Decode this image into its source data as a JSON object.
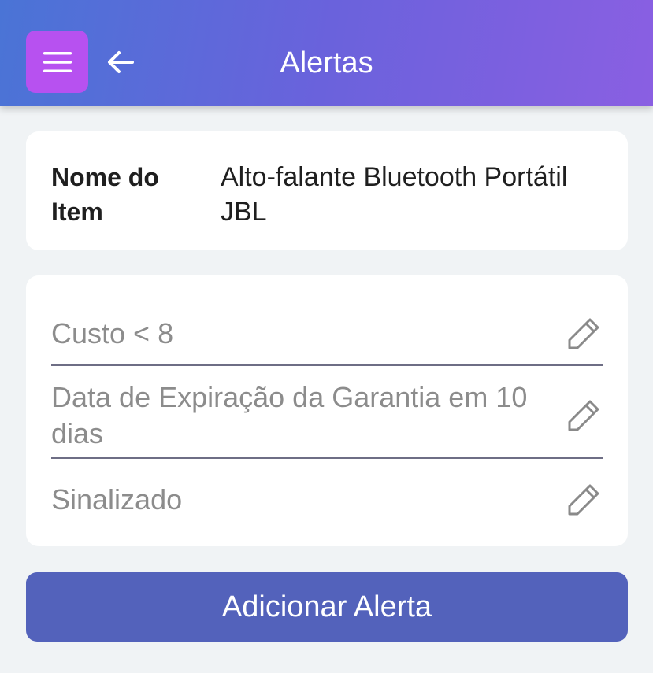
{
  "header": {
    "title": "Alertas",
    "menu_icon": "hamburger-icon",
    "back_icon": "arrow-left-icon",
    "gradient": [
      "#4a74d6",
      "#8a5fe2"
    ],
    "menu_button_color": "#b751f0"
  },
  "item": {
    "label": "Nome do Item",
    "value": "Alto-falante Bluetooth Portátil JBL"
  },
  "alerts": [
    {
      "text": "Custo < 8",
      "icon": "pencil-icon"
    },
    {
      "text": "Data de Expiração da Garantia em 10 dias",
      "icon": "pencil-icon"
    },
    {
      "text": "Sinalizado",
      "icon": "pencil-icon"
    }
  ],
  "add_button": {
    "label": "Adicionar Alerta",
    "color": "#5362bb"
  }
}
